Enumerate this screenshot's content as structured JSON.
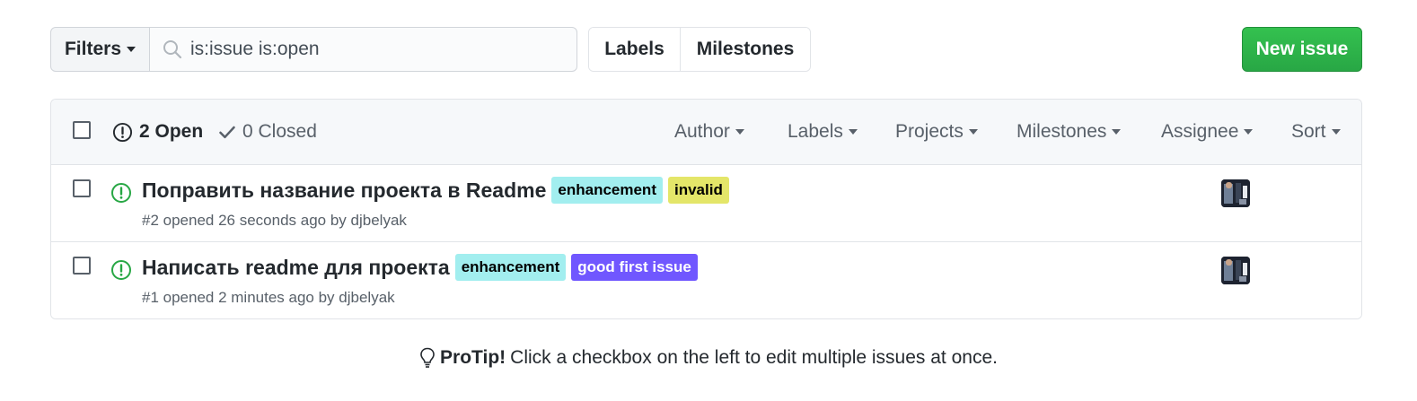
{
  "toolbar": {
    "filters_label": "Filters",
    "search_value": "is:issue is:open",
    "labels_label": "Labels",
    "milestones_label": "Milestones",
    "new_issue_label": "New issue"
  },
  "header": {
    "open_count_label": "2 Open",
    "closed_count_label": "0 Closed",
    "filters": [
      "Author",
      "Labels",
      "Projects",
      "Milestones",
      "Assignee",
      "Sort"
    ]
  },
  "issues": [
    {
      "title": "Поправить название проекта в Readme",
      "labels": [
        {
          "name": "enhancement",
          "bg": "#a2eeef",
          "fg": "#000000"
        },
        {
          "name": "invalid",
          "bg": "#e4e669",
          "fg": "#000000"
        }
      ],
      "meta": "#2 opened 26 seconds ago by djbelyak"
    },
    {
      "title": "Написать readme для проекта",
      "labels": [
        {
          "name": "enhancement",
          "bg": "#a2eeef",
          "fg": "#000000"
        },
        {
          "name": "good first issue",
          "bg": "#7057ff",
          "fg": "#ffffff"
        }
      ],
      "meta": "#1 opened 2 minutes ago by djbelyak"
    }
  ],
  "protip": {
    "strong": "ProTip!",
    "text": "Click a checkbox on the left to edit multiple issues at once."
  },
  "colors": {
    "open_green": "#28a745",
    "new_issue_green": "#2ea44f",
    "muted": "#586069"
  }
}
